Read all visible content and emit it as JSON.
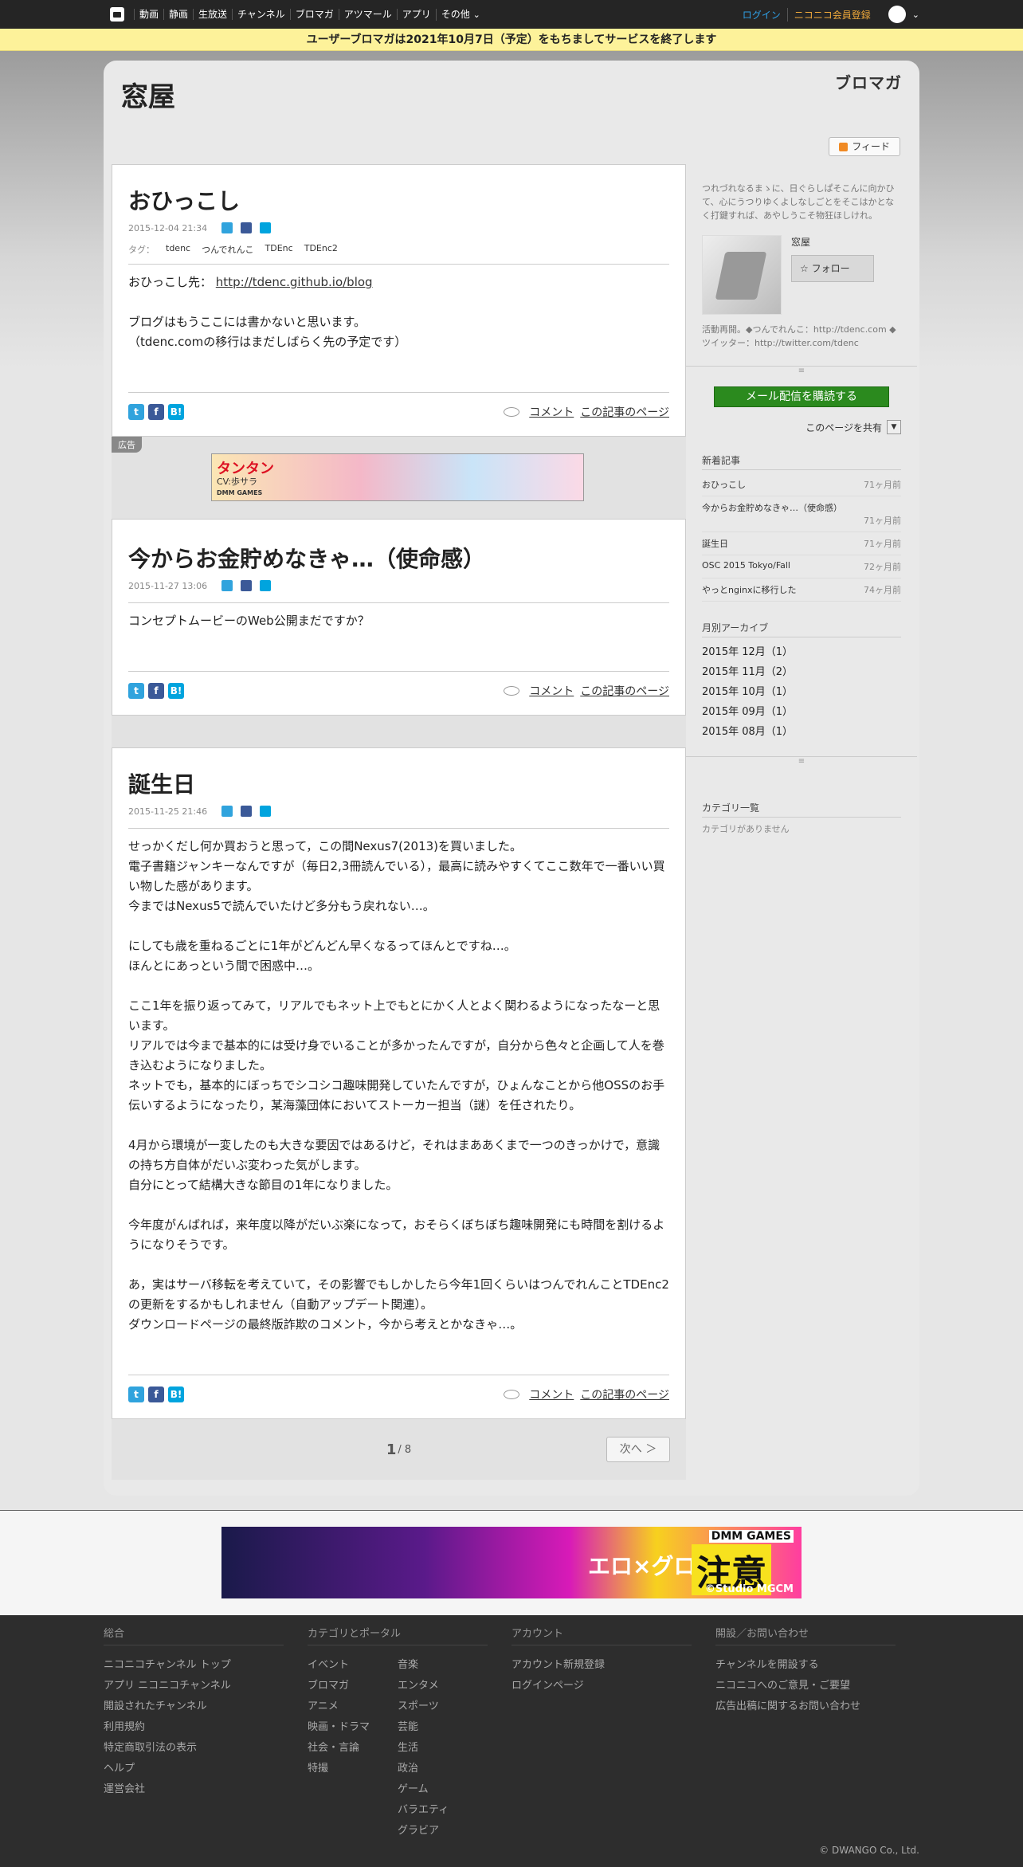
{
  "topnav": {
    "items": [
      "動画",
      "静画",
      "生放送",
      "チャンネル",
      "ブロマガ",
      "アツマール",
      "アプリ",
      "その他"
    ],
    "login": "ログイン",
    "register": "ニコニコ会員登録"
  },
  "notice": "ユーザーブロマガは2021年10月7日（予定）をもちましてサービスを終了します",
  "header": {
    "title": "窓屋",
    "logo": "ブロマガ",
    "feed": "フィード"
  },
  "articles": [
    {
      "title": "おひっこし",
      "date": "2015-12-04 21:34",
      "tag_label": "タグ：",
      "tags": [
        "tdenc",
        "つんでれんこ",
        "TDEnc",
        "TDEnc2"
      ],
      "body": [
        "おひっこし先：",
        "",
        "ブログはもうここには書かないと思います。",
        "（tdenc.comの移行はまだしばらく先の予定です）"
      ],
      "link": "http://tdenc.github.io/blog"
    },
    {
      "title": "今からお金貯めなきゃ…（使命感）",
      "date": "2015-11-27 13:06",
      "body": [
        "コンセプトムービーのWeb公開まだですか？"
      ]
    },
    {
      "title": "誕生日",
      "date": "2015-11-25 21:46",
      "body": [
        "せっかくだし何か買おうと思って，この間Nexus7(2013)を買いました。",
        "電子書籍ジャンキーなんですが（毎日2,3冊読んでいる），最高に読みやすくてここ数年で一番いい買い物した感があります。",
        "今まではNexus5で読んでいたけど多分もう戻れない…。",
        "",
        "にしても歳を重ねるごとに1年がどんどん早くなるってほんとですね…。",
        "ほんとにあっという間で困惑中…。",
        "",
        "ここ1年を振り返ってみて，リアルでもネット上でもとにかく人とよく関わるようになったなーと思います。",
        "リアルでは今まで基本的には受け身でいることが多かったんですが，自分から色々と企画して人を巻き込むようになりました。",
        "ネットでも，基本的にぼっちでシコシコ趣味開発していたんですが，ひょんなことから他OSSのお手伝いするようになったり，某海藻団体においてストーカー担当（謎）を任されたり。",
        "",
        "4月から環境が一変したのも大きな要因ではあるけど，それはまああくまで一つのきっかけで，意識の持ち方自体がだいぶ変わった気がします。",
        "自分にとって結構大きな節目の1年になりました。",
        "",
        "今年度がんばれば，来年度以降がだいぶ楽になって，おそらくぼちぼち趣味開発にも時間を割けるようになりそうです。",
        "",
        "あ，実はサーバ移転を考えていて，その影響でもしかしたら今年1回くらいはつんでれんことTDEnc2の更新をするかもしれません（自動アップデート関連）。",
        "ダウンロードページの最終版詐欺のコメント，今から考えとかなきゃ…。"
      ]
    }
  ],
  "article_links": {
    "comment": "コメント",
    "page": "この記事のページ"
  },
  "ad": {
    "label": "広告",
    "banner_title": "タンタン",
    "banner_sub": "CV:歩サラ",
    "banner_brand": "DMM GAMES"
  },
  "pager": {
    "current": "1",
    "total": "/ 8",
    "next": "次へ ＞"
  },
  "sidebar": {
    "description": "つれづれなるまゝに、日ぐらしぱそこんに向かひて、心にうつりゆくよしなしごとをそこはかとなく打鍵すれば、あやしうこそ物狂ほしけれ。",
    "profile_name": "窓屋",
    "follow": "フォロー",
    "activity": "活動再開。◆つんでれんこ：http://tdenc.com ◆ツイッター：http://twitter.com/tdenc",
    "mail_button": "メール配信を購読する",
    "share_label": "このページを共有",
    "recent_title": "新着記事",
    "recent": [
      {
        "title": "おひっこし",
        "ago": "71ヶ月前"
      },
      {
        "title": "今からお金貯めなきゃ…（使命感）",
        "ago": "71ヶ月前"
      },
      {
        "title": "誕生日",
        "ago": "71ヶ月前"
      },
      {
        "title": "OSC 2015 Tokyo/Fall",
        "ago": "72ヶ月前"
      },
      {
        "title": "やっとnginxに移行した",
        "ago": "74ヶ月前"
      }
    ],
    "archive_title": "月別アーカイブ",
    "archive": [
      "2015年 12月（1）",
      "2015年 11月（2）",
      "2015年 10月（1）",
      "2015年 09月（1）",
      "2015年 08月（1）"
    ],
    "category_title": "カテゴリ一覧",
    "category_none": "カテゴリがありません"
  },
  "bottom_ad": {
    "text1": "エロ×グロ",
    "text2": "注意",
    "brand": "DMM GAMES",
    "studio": "©Studio MGCM"
  },
  "footer": {
    "cols": [
      {
        "title": "総合",
        "links": [
          "ニコニコチャンネル トップ",
          "アプリ ニコニコチャンネル",
          "開設されたチャンネル",
          "利用規約",
          "特定商取引法の表示",
          "ヘルプ",
          "運営会社"
        ]
      },
      {
        "title": "カテゴリとポータル",
        "links_a": [
          "イベント",
          "ブロマガ",
          "アニメ",
          "映画・ドラマ",
          "社会・言論",
          "特撮"
        ],
        "links_b": [
          "音楽",
          "エンタメ",
          "スポーツ",
          "芸能",
          "生活",
          "政治",
          "ゲーム",
          "バラエティ",
          "グラビア"
        ]
      },
      {
        "title": "アカウント",
        "links": [
          "アカウント新規登録",
          "ログインページ"
        ]
      },
      {
        "title": "開設／お問い合わせ",
        "links": [
          "チャンネルを開設する",
          "ニコニコへのご意見・ご要望",
          "広告出稿に関するお問い合わせ"
        ]
      }
    ],
    "copyright": "© DWANGO Co., Ltd."
  }
}
